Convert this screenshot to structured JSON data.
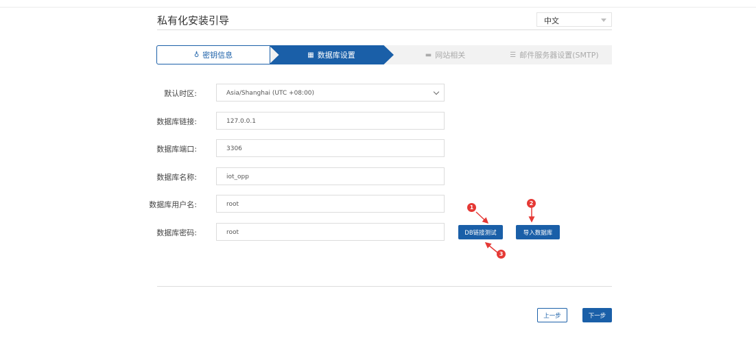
{
  "header": {
    "title": "私有化安装引导",
    "language": "中文"
  },
  "steps": [
    {
      "label": "密钥信息",
      "icon": "key-icon",
      "state": "done"
    },
    {
      "label": "数据库设置",
      "icon": "database-icon",
      "state": "active"
    },
    {
      "label": "网站相关",
      "icon": "website-icon",
      "state": "pending"
    },
    {
      "label": "邮件服务器设置(SMTP)",
      "icon": "server-icon",
      "state": "pending"
    }
  ],
  "form": {
    "timezone": {
      "label": "默认时区:",
      "value": "Asia/Shanghai (UTC +08:00)"
    },
    "db_host": {
      "label": "数据库链接:",
      "value": "127.0.0.1"
    },
    "db_port": {
      "label": "数据库端口:",
      "value": "3306"
    },
    "db_name": {
      "label": "数据库名称:",
      "value": "iot_opp"
    },
    "db_user": {
      "label": "数据库用户名:",
      "value": "root"
    },
    "db_password": {
      "label": "数据库密码:",
      "value": "root"
    }
  },
  "actions": {
    "test_db": "DB链接测试",
    "import_db": "导入数据库",
    "prev": "上一步",
    "next": "下一步"
  },
  "markers": [
    "1",
    "2",
    "3"
  ],
  "colors": {
    "accent": "#1a5fa8",
    "marker": "#e53935"
  }
}
